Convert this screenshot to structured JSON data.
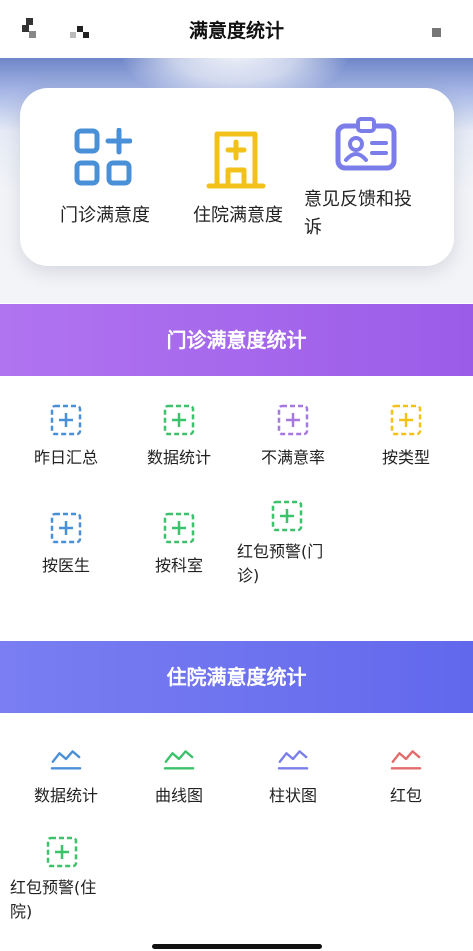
{
  "navbar": {
    "title": "满意度统计",
    "back_icon": "back-icon",
    "home_icon": "home-icon",
    "more_icon": "more-icon"
  },
  "quick_links": [
    {
      "label": "门诊满意度",
      "icon": "grid-plus-icon",
      "color": "#4a90d9"
    },
    {
      "label": "住院满意度",
      "icon": "hospital-building-icon",
      "color": "#f2c21b"
    },
    {
      "label": "意见反馈和投诉",
      "icon": "id-card-icon",
      "color": "#7b7ee8"
    }
  ],
  "outpatient": {
    "title": "门诊满意度统计",
    "items": [
      {
        "label": "昨日汇总",
        "icon": "dashed-plus-icon",
        "color": "#4a90d9"
      },
      {
        "label": "数据统计",
        "icon": "dashed-plus-icon",
        "color": "#3cc26a"
      },
      {
        "label": "不满意率",
        "icon": "dashed-plus-icon",
        "color": "#a678e0"
      },
      {
        "label": "按类型",
        "icon": "dashed-plus-icon",
        "color": "#f2c21b"
      },
      {
        "label": "按医生",
        "icon": "dashed-plus-icon",
        "color": "#4a90d9"
      },
      {
        "label": "按科室",
        "icon": "dashed-plus-icon",
        "color": "#3cc26a"
      },
      {
        "label": "红包预警(门诊)",
        "icon": "dashed-plus-icon",
        "color": "#3cc26a"
      }
    ]
  },
  "inpatient": {
    "title": "住院满意度统计",
    "items": [
      {
        "label": "数据统计",
        "icon": "line-chart-icon",
        "color": "#4a90d9"
      },
      {
        "label": "曲线图",
        "icon": "line-chart-icon",
        "color": "#3cc26a"
      },
      {
        "label": "柱状图",
        "icon": "line-chart-icon",
        "color": "#7b7ee8"
      },
      {
        "label": "红包",
        "icon": "line-chart-icon",
        "color": "#e36b6b"
      },
      {
        "label": "红包预警(住院)",
        "icon": "dashed-plus-icon",
        "color": "#3cc26a"
      }
    ]
  }
}
